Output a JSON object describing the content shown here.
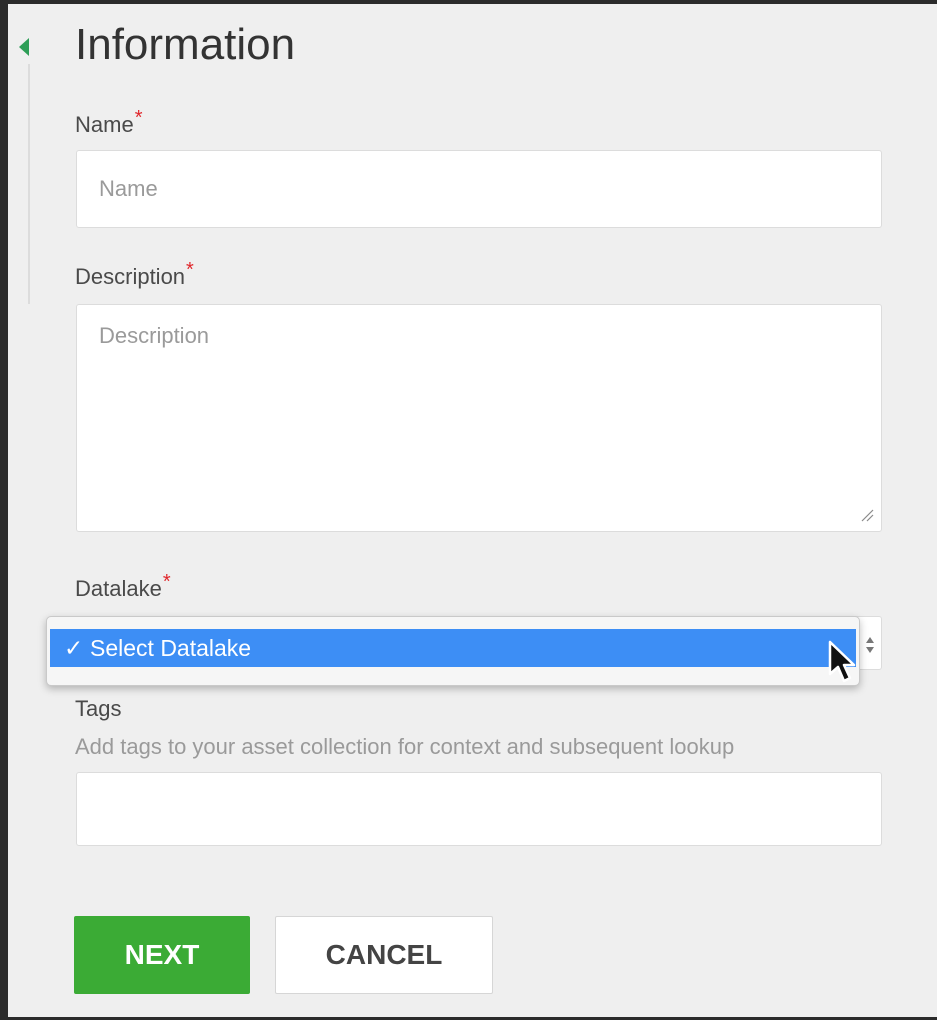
{
  "form": {
    "title": "Information",
    "required_marker": "*",
    "name": {
      "label": "Name",
      "placeholder": "Name",
      "value": ""
    },
    "description": {
      "label": "Description",
      "placeholder": "Description",
      "value": ""
    },
    "datalake": {
      "label": "Datalake",
      "selected_option": "Select Datalake",
      "check_glyph": "✓"
    },
    "tags": {
      "label": "Tags",
      "hint": "Add tags to your asset collection for context and subsequent lookup",
      "value": ""
    }
  },
  "buttons": {
    "next_label": "NEXT",
    "cancel_label": "CANCEL"
  },
  "colors": {
    "accent_green": "#3bab35",
    "required_red": "#e0262b",
    "selection_blue": "#3d8ef5"
  },
  "icons": {
    "collapse": "chevron-left-icon",
    "resize": "resize-grip-icon",
    "select_stepper": "up-down-stepper-icon",
    "pointer": "mouse-cursor-icon"
  }
}
